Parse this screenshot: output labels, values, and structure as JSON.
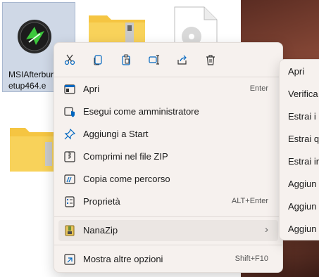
{
  "desktop": {
    "selected_file": {
      "name_line1": "MSIAfterbur",
      "name_line2": "etup464.e"
    }
  },
  "toolbar": {
    "buttons": [
      {
        "name": "cut-icon"
      },
      {
        "name": "copy-icon"
      },
      {
        "name": "paste-icon"
      },
      {
        "name": "rename-icon"
      },
      {
        "name": "share-icon"
      },
      {
        "name": "delete-icon"
      }
    ]
  },
  "menu": {
    "items": [
      {
        "label": "Apri",
        "shortcut": "Enter",
        "icon": "open-icon"
      },
      {
        "label": "Esegui come amministratore",
        "shortcut": "",
        "icon": "shield-icon"
      },
      {
        "label": "Aggiungi a Start",
        "shortcut": "",
        "icon": "pin-icon"
      },
      {
        "label": "Comprimi nel file ZIP",
        "shortcut": "",
        "icon": "zip-icon"
      },
      {
        "label": "Copia come percorso",
        "shortcut": "",
        "icon": "copy-path-icon"
      },
      {
        "label": "Proprietà",
        "shortcut": "ALT+Enter",
        "icon": "properties-icon"
      }
    ],
    "nanazip": {
      "label": "NanaZip",
      "icon": "nanazip-icon"
    },
    "more": {
      "label": "Mostra altre opzioni",
      "shortcut": "Shift+F10",
      "icon": "more-options-icon"
    }
  },
  "submenu": {
    "items": [
      "Apri",
      "Verifica",
      "Estrai i",
      "Estrai q",
      "Estrai ir",
      "Aggiun",
      "Aggiun",
      "Aggiun"
    ]
  },
  "colors": {
    "accent": "#0067c0",
    "menu_bg": "#f6f1ee",
    "folder": "#f5c542"
  }
}
